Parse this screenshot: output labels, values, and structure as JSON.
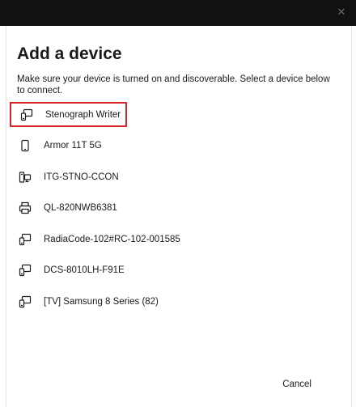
{
  "window": {
    "close_glyph": "✕"
  },
  "dialog": {
    "title": "Add a device",
    "description": "Make sure your device is turned on and discoverable. Select a device below to connect."
  },
  "devices": [
    {
      "label": "Stenograph Writer",
      "icon": "device-icon",
      "selected": true
    },
    {
      "label": "Armor 11T 5G",
      "icon": "phone-icon"
    },
    {
      "label": "ITG-STNO-CCON",
      "icon": "computer-icon"
    },
    {
      "label": "QL-820NWB6381",
      "icon": "printer-icon"
    },
    {
      "label": "RadiaCode-102#RC-102-001585",
      "icon": "device-icon"
    },
    {
      "label": "DCS-8010LH-F91E",
      "icon": "device-icon"
    },
    {
      "label": "[TV] Samsung 8 Series (82)",
      "icon": "device-icon"
    }
  ],
  "footer": {
    "cancel_label": "Cancel"
  },
  "colors": {
    "highlight": "#d7242a",
    "titlebar": "#111111"
  }
}
